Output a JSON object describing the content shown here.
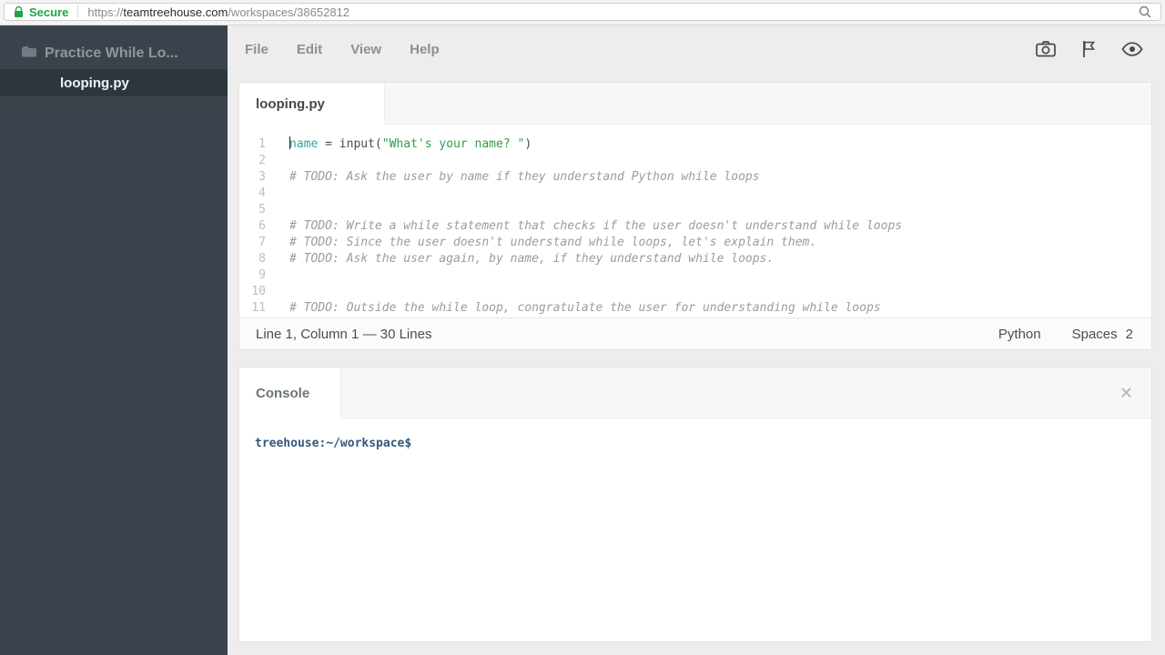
{
  "browser": {
    "secure_label": "Secure",
    "url_prefix": "https://",
    "url_host": "teamtreehouse.com",
    "url_path": "/workspaces/38652812"
  },
  "sidebar": {
    "project_name": "Practice While Lo...",
    "files": [
      {
        "name": "looping.py",
        "active": true
      }
    ]
  },
  "menubar": {
    "items": [
      "File",
      "Edit",
      "View",
      "Help"
    ],
    "icons": [
      "camera-icon",
      "flag-icon",
      "eye-icon"
    ]
  },
  "editor": {
    "tab": "looping.py",
    "cursor_line": 1,
    "lines": [
      {
        "num": 1,
        "segments": [
          {
            "t": "name",
            "c": "var"
          },
          {
            "t": " = input(",
            "c": "plain"
          },
          {
            "t": "\"What's your name? \"",
            "c": "str"
          },
          {
            "t": ")",
            "c": "plain"
          }
        ]
      },
      {
        "num": 2,
        "segments": []
      },
      {
        "num": 3,
        "segments": [
          {
            "t": "# TODO: Ask the user by name if they understand Python while loops",
            "c": "comment"
          }
        ]
      },
      {
        "num": 4,
        "segments": []
      },
      {
        "num": 5,
        "segments": []
      },
      {
        "num": 6,
        "segments": [
          {
            "t": "# TODO: Write a while statement that checks if the user doesn't understand while loops",
            "c": "comment"
          }
        ]
      },
      {
        "num": 7,
        "segments": [
          {
            "t": "# TODO: Since the user doesn't understand while loops, let's explain them.",
            "c": "comment"
          }
        ]
      },
      {
        "num": 8,
        "segments": [
          {
            "t": "# TODO: Ask the user again, by name, if they understand while loops.",
            "c": "comment"
          }
        ]
      },
      {
        "num": 9,
        "segments": []
      },
      {
        "num": 10,
        "segments": []
      },
      {
        "num": 11,
        "segments": [
          {
            "t": "# TODO: Outside the while loop, congratulate the user for understanding while loops",
            "c": "comment"
          }
        ]
      }
    ],
    "status": {
      "position": "Line 1, Column 1 — 30 Lines",
      "language": "Python",
      "indent_label": "Spaces",
      "indent_value": "2"
    }
  },
  "console": {
    "tab": "Console",
    "close_glyph": "✕",
    "prompt": "treehouse:~/workspace$"
  },
  "colors": {
    "sidebar_bg": "#3a434b",
    "sidebar_active_bg": "#2e363d",
    "secure_green": "#1ea446",
    "variable": "#2aa79e",
    "string": "#2f9e44",
    "comment": "#9c9c9c",
    "console_prompt": "#33587c"
  }
}
